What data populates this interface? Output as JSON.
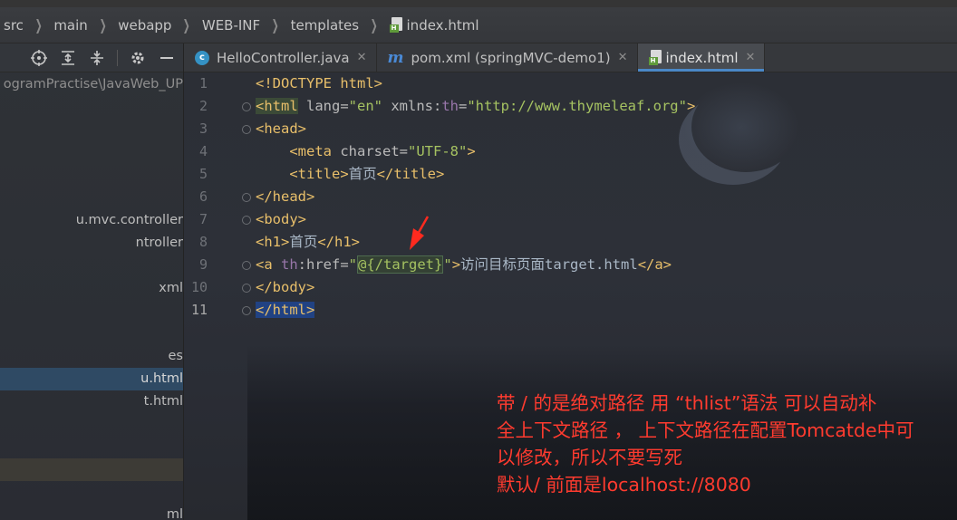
{
  "breadcrumb": {
    "items": [
      "src",
      "main",
      "webapp",
      "WEB-INF",
      "templates"
    ],
    "file": "index.html"
  },
  "sidebar": {
    "toolbar_icons": [
      "crosshair-icon",
      "expand-all-icon",
      "collapse-all-icon",
      "gear-icon",
      "minimize-icon"
    ],
    "tree": [
      {
        "text": "ogramPractise\\JavaWeb_UP",
        "state": "dim"
      },
      {
        "text": "u.mvc.controller",
        "state": "normal"
      },
      {
        "text": "ntroller",
        "state": "normal"
      },
      {
        "text": "xml",
        "state": "normal"
      },
      {
        "text": "es",
        "state": "normal"
      },
      {
        "text": "u.html",
        "state": "selected"
      },
      {
        "text": "t.html",
        "state": "normal"
      },
      {
        "text": "",
        "state": "highlight"
      },
      {
        "text": "ml",
        "state": "normal"
      }
    ]
  },
  "tabs": [
    {
      "label": "HelloController.java",
      "icon": "java-class-icon",
      "active": false
    },
    {
      "label": "pom.xml (springMVC-demo1)",
      "icon": "maven-icon",
      "active": false
    },
    {
      "label": "index.html",
      "icon": "html-file-icon",
      "active": true
    }
  ],
  "editor": {
    "line_numbers": [
      "1",
      "2",
      "3",
      "4",
      "5",
      "6",
      "7",
      "8",
      "9",
      "10",
      "11"
    ],
    "current_line": "11",
    "code": {
      "l1": {
        "tag": "<!DOCTYPE",
        "rest": " html>"
      },
      "l2": {
        "open": "<html",
        "a1": " lang=",
        "v1": "\"en\"",
        "a2": " xmlns:",
        "ns": "th",
        "eq": "=",
        "v2": "\"http://www.thymeleaf.org\"",
        "close": ">"
      },
      "l3": {
        "tag": "<head>"
      },
      "l4": {
        "open": "    <meta",
        "a1": " charset=",
        "v1": "\"UTF-8\"",
        "close": ">"
      },
      "l5": {
        "open": "    <title>",
        "text": "首页",
        "close": "</title>"
      },
      "l6": {
        "tag": "</head>"
      },
      "l7": {
        "tag": "<body>"
      },
      "l8": {
        "open": "<h1>",
        "text": "首页",
        "close": "</h1>"
      },
      "l9": {
        "open": "<a",
        "ns": " th",
        "a1": ":href=",
        "q1": "\"",
        "expr": "@{/target}",
        "q2": "\"",
        "close": ">",
        "text": "访问目标页面target.html",
        "end": "</a>"
      },
      "l10": {
        "tag": "</body>"
      },
      "l11": {
        "tag": "</html>"
      }
    }
  },
  "annotation": {
    "lines": [
      "带 / 的是绝对路径 用 “thlist”语法 可以自动补",
      "全上下文路径 ， 上下文路径在配置Tomcatde中可",
      "以修改，所以不要写死",
      "默认/ 前面是localhost://8080"
    ],
    "color": "#ff3b2f"
  },
  "colors": {
    "tag": "#e8bf6a",
    "string": "#6a8759",
    "namespace": "#9876aa",
    "accent": "#4a88c7"
  }
}
